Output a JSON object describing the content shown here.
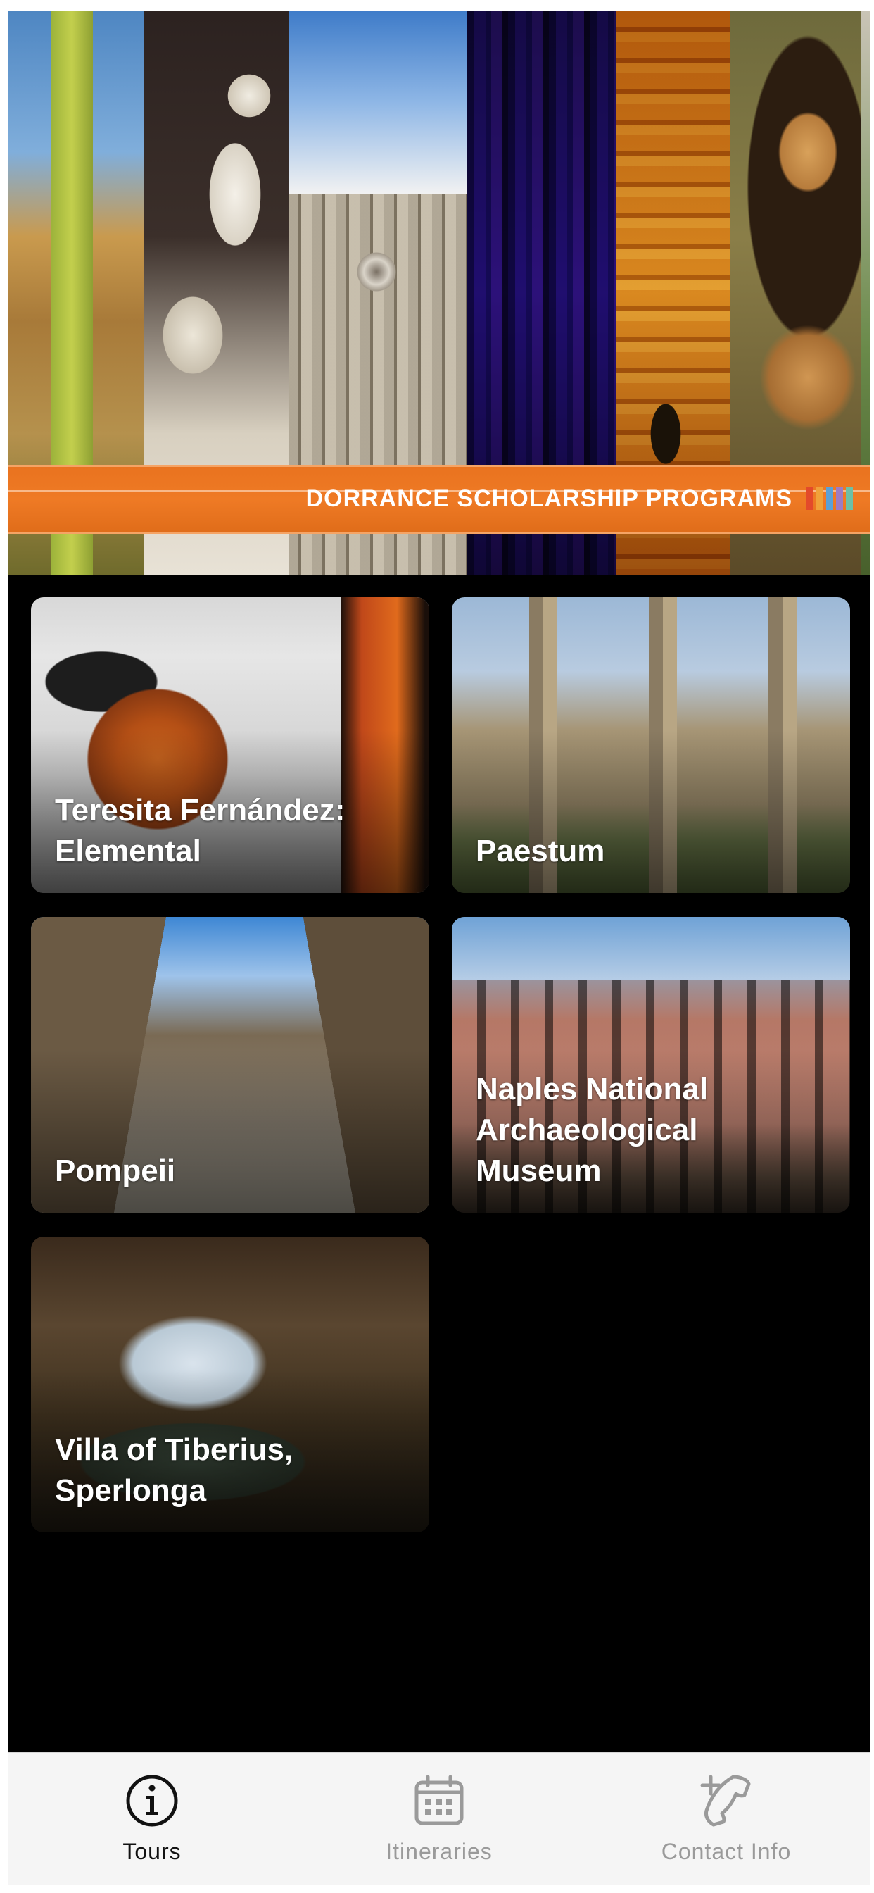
{
  "banner": {
    "title": "DORRANCE SCHOLARSHIP PROGRAMS",
    "accent_color": "#ef7a25",
    "stripe_colors": [
      "#e34a2b",
      "#f0a13a",
      "#5aa1d6",
      "#9d7bc4",
      "#6cc0a6"
    ]
  },
  "tours": [
    {
      "name": "Teresita Fernández:\nElemental"
    },
    {
      "name": "Paestum"
    },
    {
      "name": "Pompeii"
    },
    {
      "name": "Naples National\nArchaeological\nMuseum"
    },
    {
      "name": "Villa of Tiberius,\nSperlonga"
    }
  ],
  "tabbar": {
    "tabs": [
      {
        "label": "Tours",
        "icon": "info-circle-icon",
        "active": true
      },
      {
        "label": "Itineraries",
        "icon": "calendar-icon",
        "active": false
      },
      {
        "label": "Contact Info",
        "icon": "add-phone-icon",
        "active": false
      }
    ]
  }
}
